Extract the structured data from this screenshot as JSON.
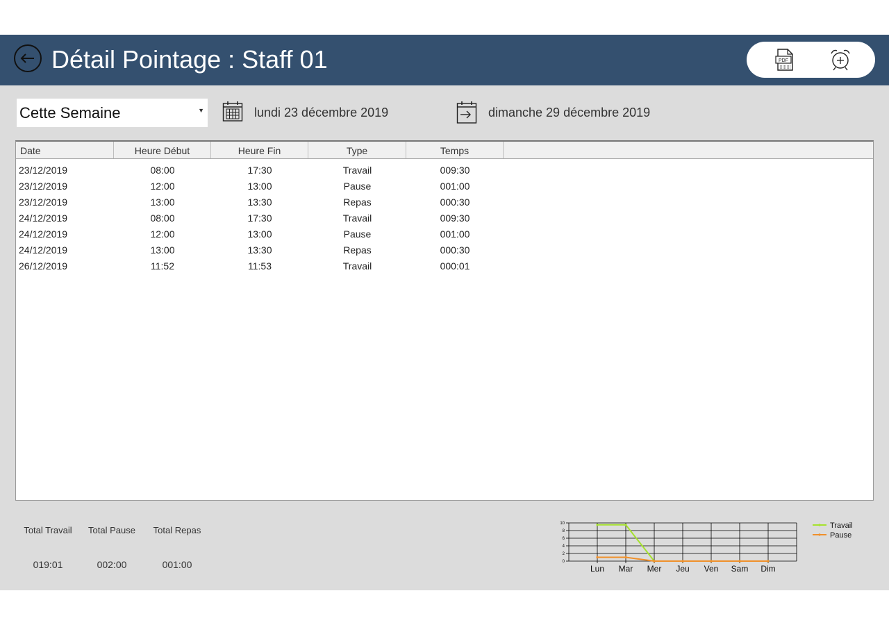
{
  "header": {
    "title": "Détail Pointage : Staff 01",
    "pdf_icon_text": "PDF"
  },
  "filters": {
    "period_selected": "Cette Semaine",
    "start_date": "lundi 23 décembre 2019",
    "end_date": "dimanche 29 décembre 2019"
  },
  "table": {
    "columns": [
      "Date",
      "Heure Début",
      "Heure Fin",
      "Type",
      "Temps"
    ],
    "rows": [
      [
        "23/12/2019",
        "08:00",
        "17:30",
        "Travail",
        "009:30"
      ],
      [
        "23/12/2019",
        "12:00",
        "13:00",
        "Pause",
        "001:00"
      ],
      [
        "23/12/2019",
        "13:00",
        "13:30",
        "Repas",
        "000:30"
      ],
      [
        "24/12/2019",
        "08:00",
        "17:30",
        "Travail",
        "009:30"
      ],
      [
        "24/12/2019",
        "12:00",
        "13:00",
        "Pause",
        "001:00"
      ],
      [
        "24/12/2019",
        "13:00",
        "13:30",
        "Repas",
        "000:30"
      ],
      [
        "26/12/2019",
        "11:52",
        "11:53",
        "Travail",
        "000:01"
      ]
    ]
  },
  "totals": {
    "travail_label": "Total Travail",
    "travail_value": "019:01",
    "pause_label": "Total Pause",
    "pause_value": "002:00",
    "repas_label": "Total Repas",
    "repas_value": "001:00"
  },
  "chart_data": {
    "type": "line",
    "categories": [
      "Lun",
      "Mar",
      "Mer",
      "Jeu",
      "Ven",
      "Sam",
      "Dim"
    ],
    "series": [
      {
        "name": "Travail",
        "values": [
          9.5,
          9.5,
          0,
          0,
          0,
          0,
          0
        ],
        "color": "#a6e22e"
      },
      {
        "name": "Pause",
        "values": [
          1,
          1,
          0,
          0,
          0,
          0,
          0
        ],
        "color": "#f0902a"
      }
    ],
    "y_ticks": [
      "0",
      "2",
      "4",
      "6",
      "8",
      "10"
    ],
    "ylim": [
      0,
      10
    ],
    "grid": true,
    "legend": "right"
  },
  "colors": {
    "header_bg": "#34506f",
    "app_bg": "#dcdcdc"
  }
}
